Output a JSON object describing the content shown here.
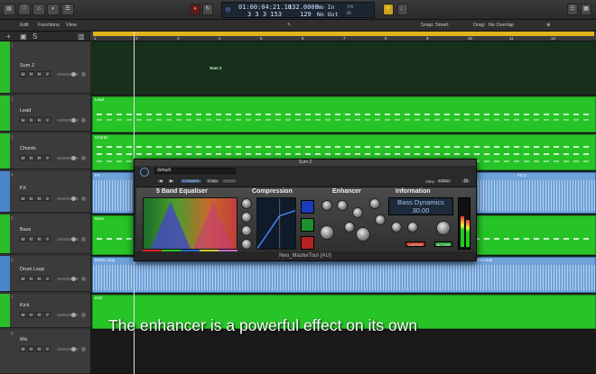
{
  "transport": {
    "position_time": "01:00:04:21.10",
    "position_bars": "3 3 3 153",
    "tempo": "132.0000",
    "tempo_sub": "129",
    "input_label": "No In",
    "output_label": "No Out",
    "cpu_label": "CPU",
    "hd_label": "HD"
  },
  "menu": {
    "edit": "Edit",
    "functions": "Functions",
    "view": "View",
    "snap_label": "Snap:",
    "snap_value": "Smart",
    "drag_label": "Drag:",
    "drag_value": "No Overlap"
  },
  "ruler": {
    "marks": [
      "1",
      "2",
      "3",
      "4",
      "5",
      "6",
      "7",
      "8",
      "9",
      "10",
      "11",
      "12"
    ]
  },
  "tracks": [
    {
      "num": "1",
      "name": "Sum 2"
    },
    {
      "num": "2",
      "name": "Lead"
    },
    {
      "num": "3",
      "name": "Chords"
    },
    {
      "num": "4",
      "name": "FX"
    },
    {
      "num": "5",
      "name": "Bass"
    },
    {
      "num": "6",
      "name": "Drum Loop"
    },
    {
      "num": "7",
      "name": "Kick"
    },
    {
      "num": "8",
      "name": "Mic"
    }
  ],
  "regions": {
    "sum": "Sum 2",
    "lead": "Lead",
    "chords": "Chords",
    "fx_a": "FX",
    "fx_b": "FX.2",
    "bass": "Bass",
    "drum_a": "Drum Loop",
    "drum_b": "Drum Loop",
    "kick": "Kick"
  },
  "plugin": {
    "window_title": "Sum 2",
    "preset": "default",
    "compare": "Compare",
    "copy": "Copy",
    "paste": "Paste",
    "view_label": "View:",
    "view_value": "Editor",
    "sections": {
      "eq": "5 Band Equaliser",
      "comp": "Compression",
      "enh": "Enhancer",
      "info": "Information"
    },
    "info_line1": "Bass Dynamics",
    "info_line2": "30.00",
    "limiter_label": "LIMITER",
    "active_label": "ACTIVE",
    "footer": "Neo_MasterTool (AU)"
  },
  "caption": "The enhancer is a powerful effect on its own"
}
